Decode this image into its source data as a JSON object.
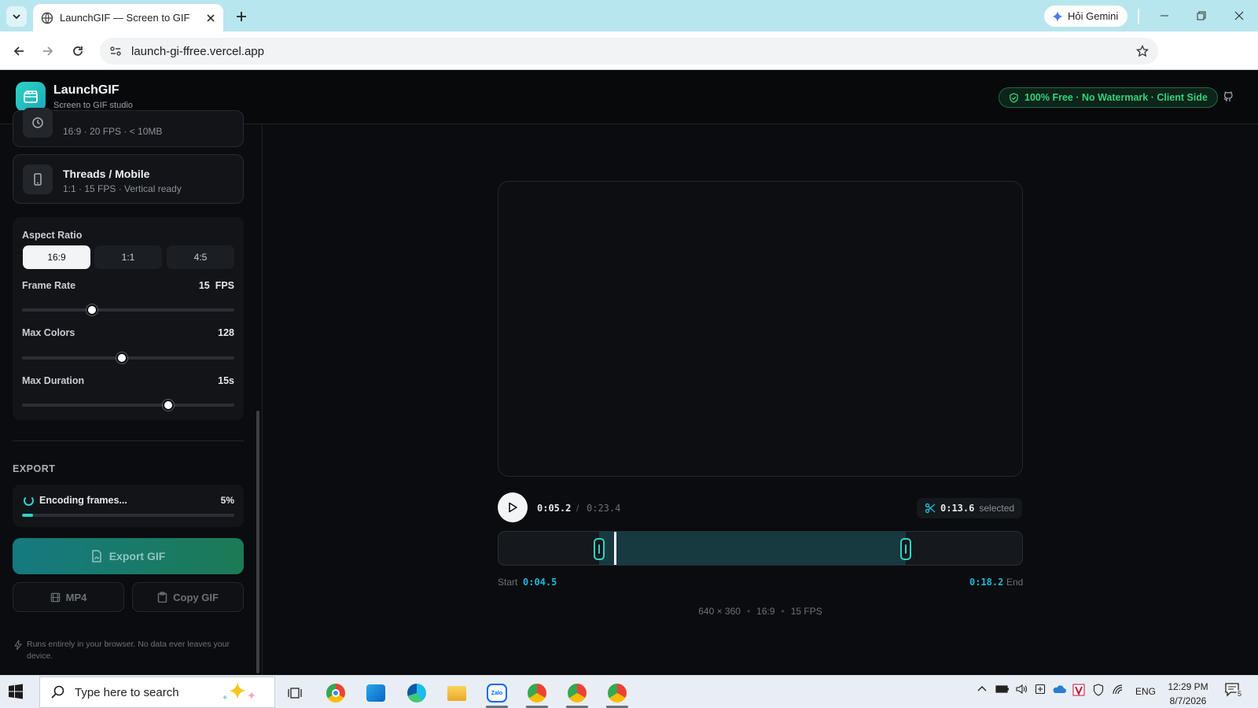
{
  "browser": {
    "tab_title": "LaunchGIF — Screen to GIF Studio",
    "url": "launch-gi-ffree.vercel.app",
    "gemini_label": "Hỏi Gemini"
  },
  "app": {
    "name": "LaunchGIF",
    "tagline": "Screen to GIF studio",
    "badge": "100% Free · No Watermark · Client Side",
    "accent": "#2fd3c6"
  },
  "presets": [
    {
      "title": "",
      "sub": "16:9 · 20 FPS · < 10MB",
      "icon": "clock-icon"
    },
    {
      "title": "Threads / Mobile",
      "sub": "1:1 · 15 FPS · Vertical ready",
      "icon": "phone-icon"
    }
  ],
  "settings": {
    "aspect_label": "Aspect Ratio",
    "aspect_options": [
      "16:9",
      "1:1",
      "4:5"
    ],
    "aspect_selected": "16:9",
    "frame_rate": {
      "label": "Frame Rate",
      "value": "15",
      "unit": "FPS",
      "fraction": 0.33
    },
    "max_colors": {
      "label": "Max Colors",
      "value": "128",
      "fraction": 0.47
    },
    "max_duration": {
      "label": "Max Duration",
      "value": "15s",
      "fraction": 0.69
    }
  },
  "export": {
    "heading": "EXPORT",
    "status": "Encoding frames...",
    "percent_label": "5%",
    "progress": 0.05,
    "export_button": "Export GIF",
    "mp4_button": "MP4",
    "copy_button": "Copy GIF",
    "note": "Runs entirely in your browser. No data ever leaves your device."
  },
  "player": {
    "current": "0:05.2",
    "separator": "/",
    "total": "0:23.4",
    "selected_value": "0:13.6",
    "selected_label": "selected",
    "start_label": "Start",
    "start_value": "0:04.5",
    "end_value": "0:18.2",
    "end_label": "End",
    "meta": {
      "resolution": "640 × 360",
      "aspect": "16:9",
      "fps": "15 FPS"
    },
    "timeline": {
      "total_s": 23.4,
      "start_s": 4.5,
      "end_s": 18.2,
      "playhead_s": 5.2
    }
  },
  "taskbar": {
    "search_placeholder": "Type here to search",
    "lang": "ENG",
    "time": "12:29 PM",
    "date": "8/7/2026",
    "notif_count": "5"
  }
}
